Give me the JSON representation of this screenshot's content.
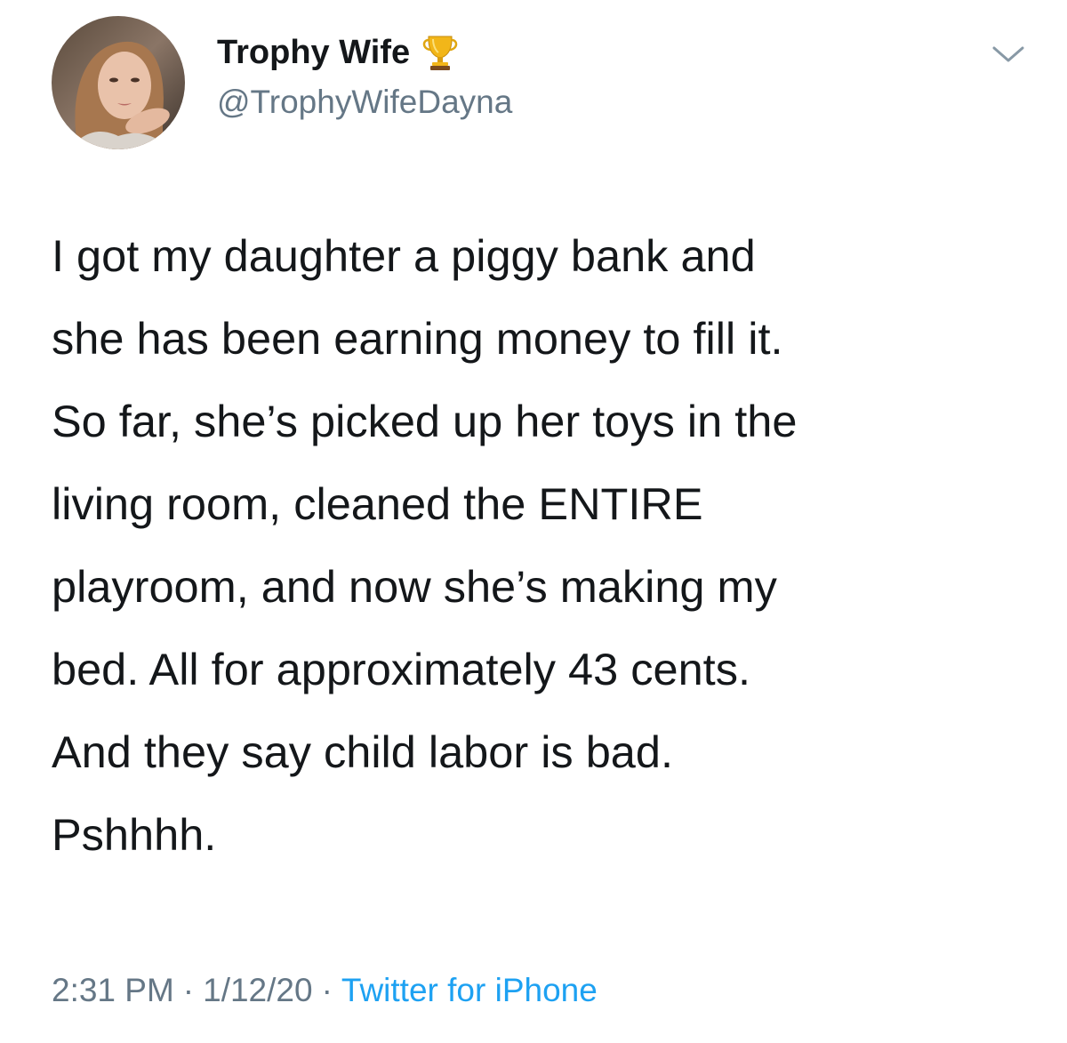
{
  "author": {
    "display_name": "Trophy Wife",
    "handle": "@TrophyWifeDayna",
    "badge_icon": "trophy-icon",
    "avatar_icon": "profile-photo"
  },
  "menu": {
    "icon": "chevron-down-icon"
  },
  "tweet": {
    "text": "I got my daughter a piggy bank and\nshe has been earning money to fill it.\nSo far, she’s picked up her toys in the\nliving room, cleaned the ENTIRE\nplayroom, and now she’s making my\nbed. All for approximately 43 cents.\nAnd they say child labor is bad.\nPshhhh."
  },
  "meta": {
    "time": "2:31 PM",
    "separator": "·",
    "date": "1/12/20",
    "source": "Twitter for iPhone"
  },
  "colors": {
    "text": "#14171a",
    "secondary": "#657786",
    "link": "#1da1f2",
    "background": "#ffffff"
  }
}
